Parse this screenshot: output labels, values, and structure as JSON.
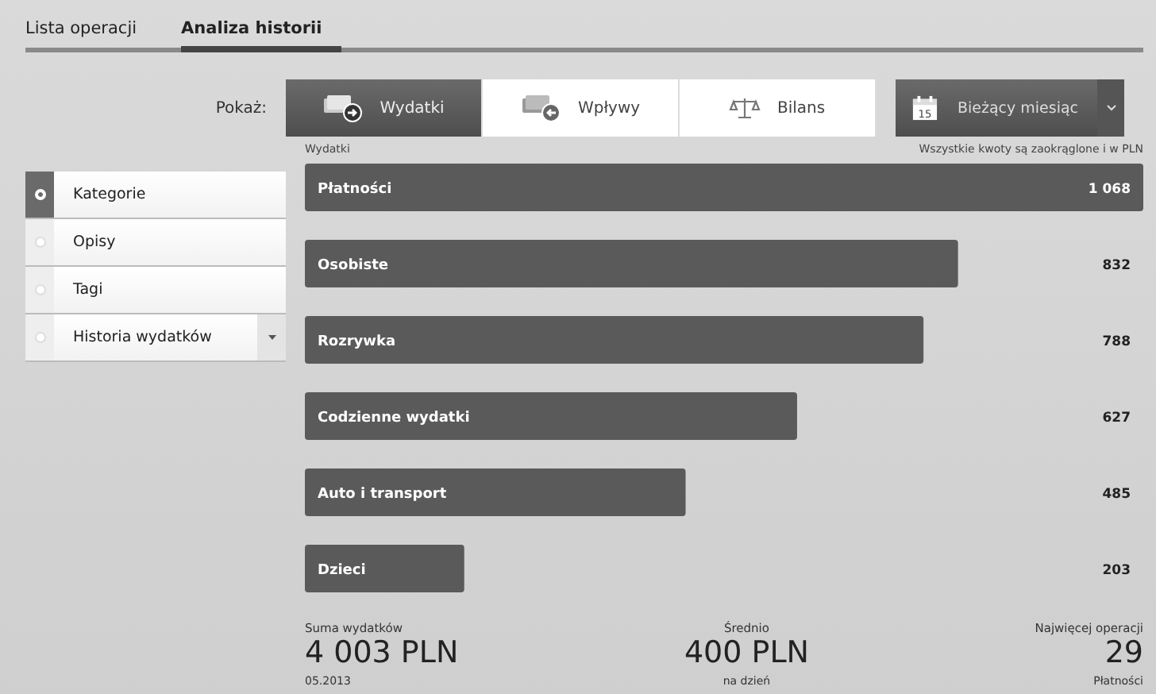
{
  "tabs": [
    {
      "label": "Lista operacji",
      "selected": false
    },
    {
      "label": "Analiza historii",
      "selected": true
    }
  ],
  "show_label": "Pokaż:",
  "view_buttons": [
    {
      "label": "Wydatki",
      "kind": "expenses",
      "selected": true
    },
    {
      "label": "Wpływy",
      "kind": "income",
      "selected": false
    },
    {
      "label": "Bilans",
      "kind": "balance",
      "selected": false
    }
  ],
  "period": {
    "label": "Bieżący miesiąc",
    "calendar_day": "15"
  },
  "sidebar": {
    "items": [
      {
        "label": "Kategorie",
        "kind": "radio",
        "selected": true
      },
      {
        "label": "Opisy",
        "kind": "radio",
        "selected": false
      },
      {
        "label": "Tagi",
        "kind": "radio",
        "selected": false
      },
      {
        "label": "Historia wydatków",
        "kind": "dropdown",
        "selected": false
      }
    ]
  },
  "rounding_note": "Wszystkie kwoty są zaokrąglone i w PLN",
  "chart_data": {
    "type": "bar",
    "orientation": "horizontal",
    "data_labels": true,
    "categories": [
      "Płatności",
      "Osobiste",
      "Rozrywka",
      "Codzienne wydatki",
      "Auto i transport",
      "Dzieci"
    ],
    "value_labels": [
      "1 068",
      "832",
      "788",
      "627",
      "485",
      "203"
    ],
    "series": [
      {
        "name": "Wydatki",
        "color": "#5a5a5a",
        "values": [
          1068,
          832,
          788,
          627,
          485,
          203
        ]
      }
    ]
  },
  "summary": [
    {
      "label": "Suma wydatków",
      "value": "4 003 PLN",
      "note": "05.2013"
    },
    {
      "label": "Średnio",
      "value": "400 PLN",
      "note": "na dzień"
    },
    {
      "label": "Najwięcej operacji",
      "value": "29",
      "note": "Płatności"
    }
  ]
}
